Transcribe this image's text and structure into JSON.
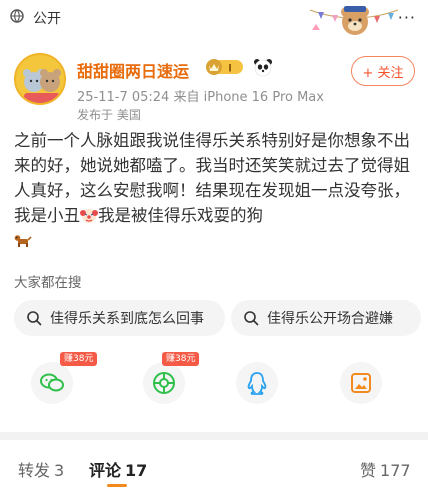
{
  "header": {
    "scope": "公开",
    "more": "···"
  },
  "author": {
    "name": "甜甜圈两日速运",
    "vip_level": "I",
    "timestamp": "25-11-7 05:24",
    "device_prefix": "来自",
    "device": "iPhone 16 Pro Max",
    "location_prefix": "发布于",
    "location": "美国",
    "follow_label": "+ 关注"
  },
  "post": {
    "text_part1": "之前一个人脉姐跟我说佳得乐关系特别好是你想象不出来的好，她说她都嗑了。我当时还笑笑就过去了觉得姐人真好，这么安慰我啊！结果现在发现姐一点没夸张，我是小丑",
    "text_part2": "我是被佳得乐戏耍的狗"
  },
  "search": {
    "title": "大家都在搜",
    "chips": [
      "佳得乐关系到底怎么回事",
      "佳得乐公开场合避嫌"
    ]
  },
  "share": {
    "earn_label_1": "赚38元",
    "earn_label_2": "赚38元",
    "icons": [
      "wechat-icon",
      "moments-icon",
      "qq-icon",
      "save-image-icon"
    ]
  },
  "tabs": {
    "repost_label": "转发",
    "repost_count": "3",
    "comment_label": "评论",
    "comment_count": "17",
    "like_label": "赞",
    "like_count": "177"
  },
  "colors": {
    "accent": "#f28a1f",
    "author": "#e86b0c",
    "follow": "#f5532c",
    "earn": "#f45a46"
  }
}
